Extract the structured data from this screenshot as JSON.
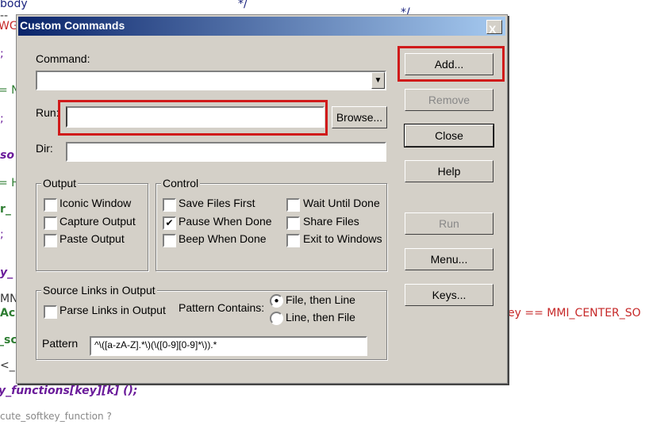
{
  "background_code": [
    "body",
    "*/",
    "--",
    "*/",
    "WG",
    ";",
    "= N",
    ";",
    "so",
    "= H",
    "r_",
    ";",
    "y_",
    "MN",
    "Ac",
    "_sc",
    "<_",
    "y_functions[key][k] ();",
    "cute_softkey_function ?",
    "ey == MMI_CENTER_SO"
  ],
  "dialog": {
    "title": "Custom Commands",
    "close_glyph": "X",
    "command_label": "Command:",
    "command_value": "",
    "dropdown_glyph": "▼",
    "run_label": "Run:",
    "run_value": "",
    "browse_label": "Browse...",
    "dir_label": "Dir:",
    "dir_value": "",
    "output_group": {
      "label": "Output",
      "items": [
        {
          "label": "Iconic Window",
          "checked": false
        },
        {
          "label": "Capture Output",
          "checked": false
        },
        {
          "label": "Paste Output",
          "checked": false
        }
      ]
    },
    "control_group": {
      "label": "Control",
      "items": [
        {
          "label": "Save Files First",
          "checked": false
        },
        {
          "label": "Pause When Done",
          "checked": true
        },
        {
          "label": "Beep When Done",
          "checked": false
        },
        {
          "label": "Wait Until Done",
          "checked": false
        },
        {
          "label": "Share Files",
          "checked": false
        },
        {
          "label": "Exit to Windows",
          "checked": false
        }
      ]
    },
    "source_links": {
      "label": "Source Links in Output",
      "parse_label": "Parse Links in Output",
      "parse_checked": false,
      "pattern_contains_label": "Pattern Contains:",
      "options": [
        {
          "label": "File, then Line",
          "selected": true
        },
        {
          "label": "Line, then File",
          "selected": false
        }
      ],
      "pattern_label": "Pattern",
      "pattern_value": "^\\([a-zA-Z].*\\)(\\([0-9][0-9]*\\)).*"
    },
    "buttons": {
      "add": "Add...",
      "remove": "Remove",
      "close": "Close",
      "help": "Help",
      "run": "Run",
      "menu": "Menu...",
      "keys": "Keys..."
    },
    "check_glyph": "✔",
    "radio_glyph": "●",
    "highlight_color": "#d01a1a"
  }
}
